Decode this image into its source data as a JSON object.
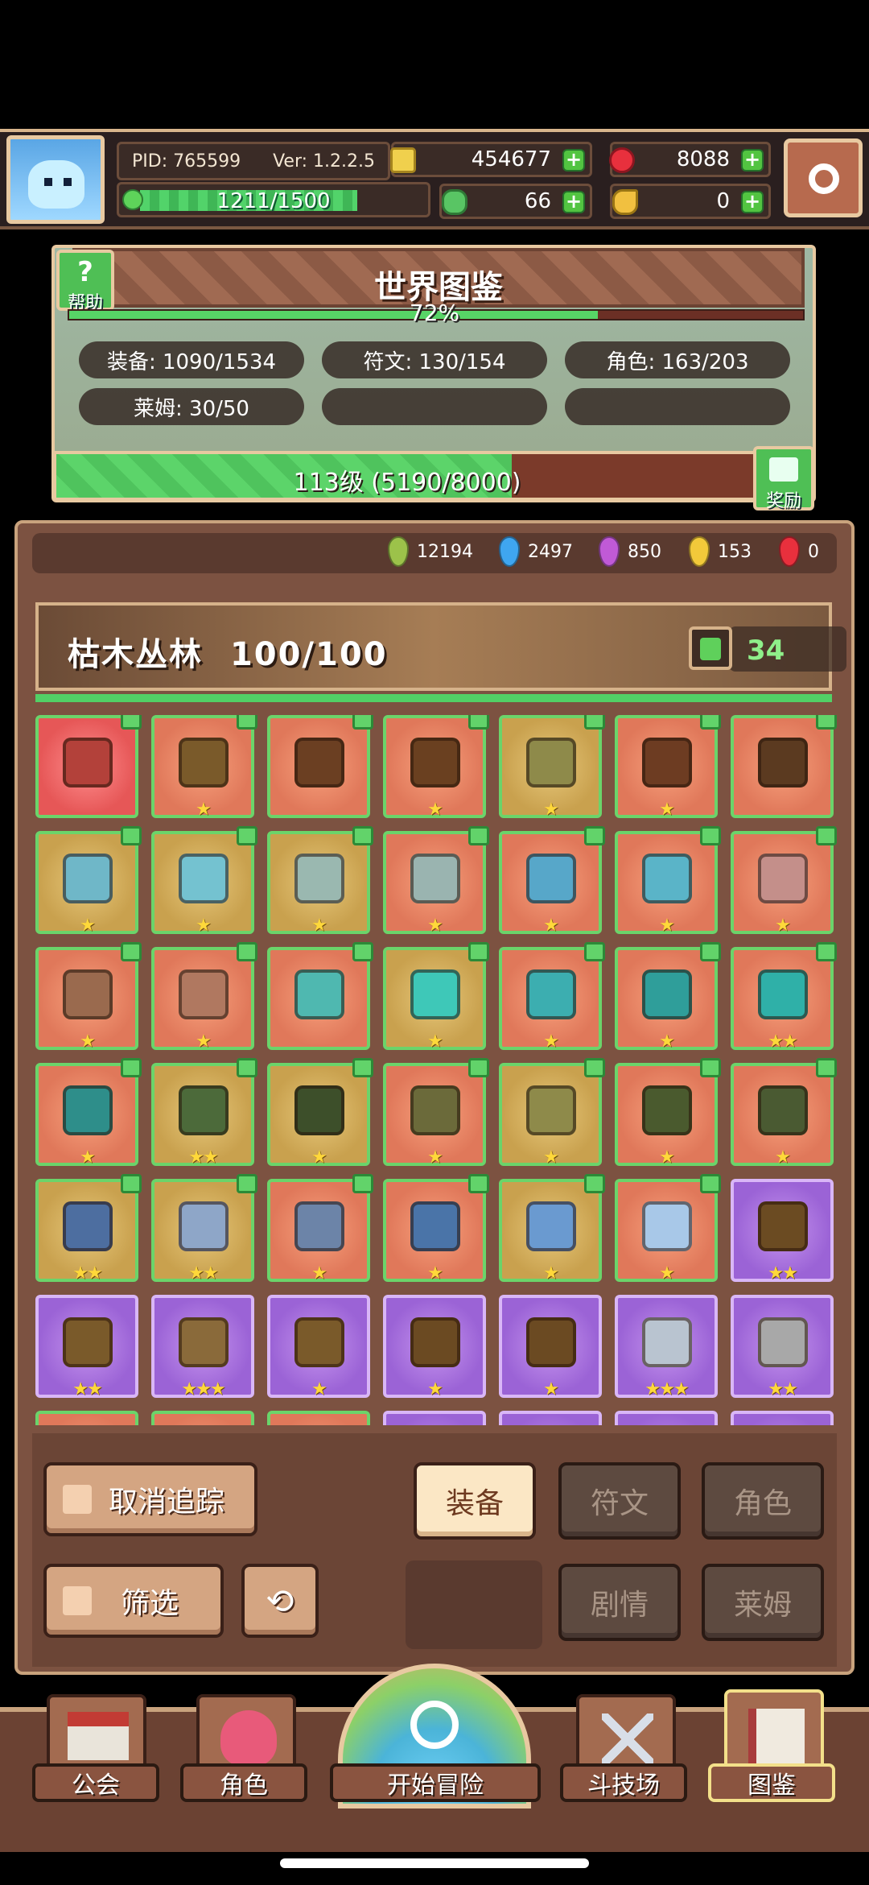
{
  "player": {
    "pid": "PID: 765599",
    "version": "Ver: 1.2.2.5",
    "xp": "1211/1500"
  },
  "resources": {
    "coins": "454677",
    "rubies": "8088",
    "clovers": "66",
    "hands": "0"
  },
  "world": {
    "help_label": "帮助",
    "title": "世界图鉴",
    "percent": "72%",
    "stats": {
      "equipment": "装备: 1090/1534",
      "runes": "符文: 130/154",
      "characters": "角色: 163/203",
      "slimes": "莱姆: 30/50"
    },
    "level": "113级 (5190/8000)",
    "level_progress": 0.649,
    "reward_label": "奖励"
  },
  "gems": [
    {
      "value": "12194",
      "color": "#9cc24a"
    },
    {
      "value": "2497",
      "color": "#3fa6f0"
    },
    {
      "value": "850",
      "color": "#c05ad6"
    },
    {
      "value": "153",
      "color": "#f2c93a"
    },
    {
      "value": "0",
      "color": "#e8303d"
    }
  ],
  "zone": {
    "name": "枯木丛林",
    "progress": "100/100",
    "likes": "34"
  },
  "grid_items": [
    {
      "bg": "red",
      "color": "#b3413a",
      "stars": "",
      "tracked": true
    },
    {
      "bg": "orange",
      "color": "#7a5a2a",
      "stars": "★",
      "tracked": true
    },
    {
      "bg": "orange",
      "color": "#6b3f22",
      "stars": "",
      "tracked": true
    },
    {
      "bg": "orange",
      "color": "#6a4020",
      "stars": "★",
      "tracked": true
    },
    {
      "bg": "gold",
      "color": "#8e8a4a",
      "stars": "★",
      "tracked": true
    },
    {
      "bg": "orange",
      "color": "#6d3c22",
      "stars": "★",
      "tracked": true
    },
    {
      "bg": "orange",
      "color": "#5b3a20",
      "stars": "",
      "tracked": true
    },
    {
      "bg": "gold",
      "color": "#6fb7c8",
      "stars": "★",
      "tracked": true
    },
    {
      "bg": "gold",
      "color": "#74c2d0",
      "stars": "★",
      "tracked": true
    },
    {
      "bg": "gold",
      "color": "#9ab8b0",
      "stars": "★",
      "tracked": true
    },
    {
      "bg": "orange",
      "color": "#9ab4b0",
      "stars": "★",
      "tracked": true
    },
    {
      "bg": "orange",
      "color": "#57a7c9",
      "stars": "★",
      "tracked": true
    },
    {
      "bg": "orange",
      "color": "#5ab4c8",
      "stars": "★",
      "tracked": true
    },
    {
      "bg": "orange",
      "color": "#c48f8a",
      "stars": "★",
      "tracked": true
    },
    {
      "bg": "orange",
      "color": "#9a6a4e",
      "stars": "★",
      "tracked": true
    },
    {
      "bg": "orange",
      "color": "#b07860",
      "stars": "★",
      "tracked": true
    },
    {
      "bg": "orange",
      "color": "#4fb8b0",
      "stars": "",
      "tracked": true
    },
    {
      "bg": "gold",
      "color": "#3ec8b8",
      "stars": "★",
      "tracked": true
    },
    {
      "bg": "orange",
      "color": "#3caeb0",
      "stars": "★",
      "tracked": true
    },
    {
      "bg": "orange",
      "color": "#2f9e9a",
      "stars": "★",
      "tracked": true
    },
    {
      "bg": "orange",
      "color": "#2fb0a8",
      "stars": "★★",
      "tracked": true
    },
    {
      "bg": "orange",
      "color": "#2e8e8a",
      "stars": "★",
      "tracked": true
    },
    {
      "bg": "gold",
      "color": "#4c6a3a",
      "stars": "★★",
      "tracked": true
    },
    {
      "bg": "gold",
      "color": "#3d4f2a",
      "stars": "★",
      "tracked": true
    },
    {
      "bg": "orange",
      "color": "#6b6a3a",
      "stars": "★",
      "tracked": true
    },
    {
      "bg": "gold",
      "color": "#8e8a4a",
      "stars": "★",
      "tracked": true
    },
    {
      "bg": "orange",
      "color": "#4a5a2e",
      "stars": "★",
      "tracked": true
    },
    {
      "bg": "orange",
      "color": "#4a5a32",
      "stars": "★",
      "tracked": true
    },
    {
      "bg": "gold",
      "color": "#4d6ea0",
      "stars": "★★",
      "tracked": true
    },
    {
      "bg": "gold",
      "color": "#8ea6c8",
      "stars": "★★",
      "tracked": true
    },
    {
      "bg": "orange",
      "color": "#6c84a8",
      "stars": "★",
      "tracked": true
    },
    {
      "bg": "orange",
      "color": "#4a74a8",
      "stars": "★",
      "tracked": true
    },
    {
      "bg": "gold",
      "color": "#6a9ad0",
      "stars": "★",
      "tracked": true
    },
    {
      "bg": "orange",
      "color": "#a8c8e8",
      "stars": "★",
      "tracked": true
    },
    {
      "bg": "purple",
      "color": "#6b4b22",
      "stars": "★★",
      "tracked": false
    },
    {
      "bg": "purple",
      "color": "#7a5a2a",
      "stars": "★★",
      "tracked": false
    },
    {
      "bg": "purple",
      "color": "#8a6a3a",
      "stars": "★★★",
      "tracked": false
    },
    {
      "bg": "purple",
      "color": "#7a5a2a",
      "stars": "★",
      "tracked": false
    },
    {
      "bg": "purple",
      "color": "#6b4a22",
      "stars": "★",
      "tracked": false
    },
    {
      "bg": "purple",
      "color": "#6b4a22",
      "stars": "★",
      "tracked": false
    },
    {
      "bg": "purple",
      "color": "#b9c4d0",
      "stars": "★★★",
      "tracked": false
    },
    {
      "bg": "purple",
      "color": "#a8a8a8",
      "stars": "★★",
      "tracked": false
    }
  ],
  "controls": {
    "untrack": "取消追踪",
    "filter": "筛选",
    "tabs": {
      "equipment": "装备",
      "runes": "符文",
      "characters": "角色",
      "story": "剧情",
      "slimes": "莱姆"
    }
  },
  "nav": {
    "guild": "公会",
    "character": "角色",
    "adventure": "开始冒险",
    "arena": "斗技场",
    "codex": "图鉴"
  }
}
